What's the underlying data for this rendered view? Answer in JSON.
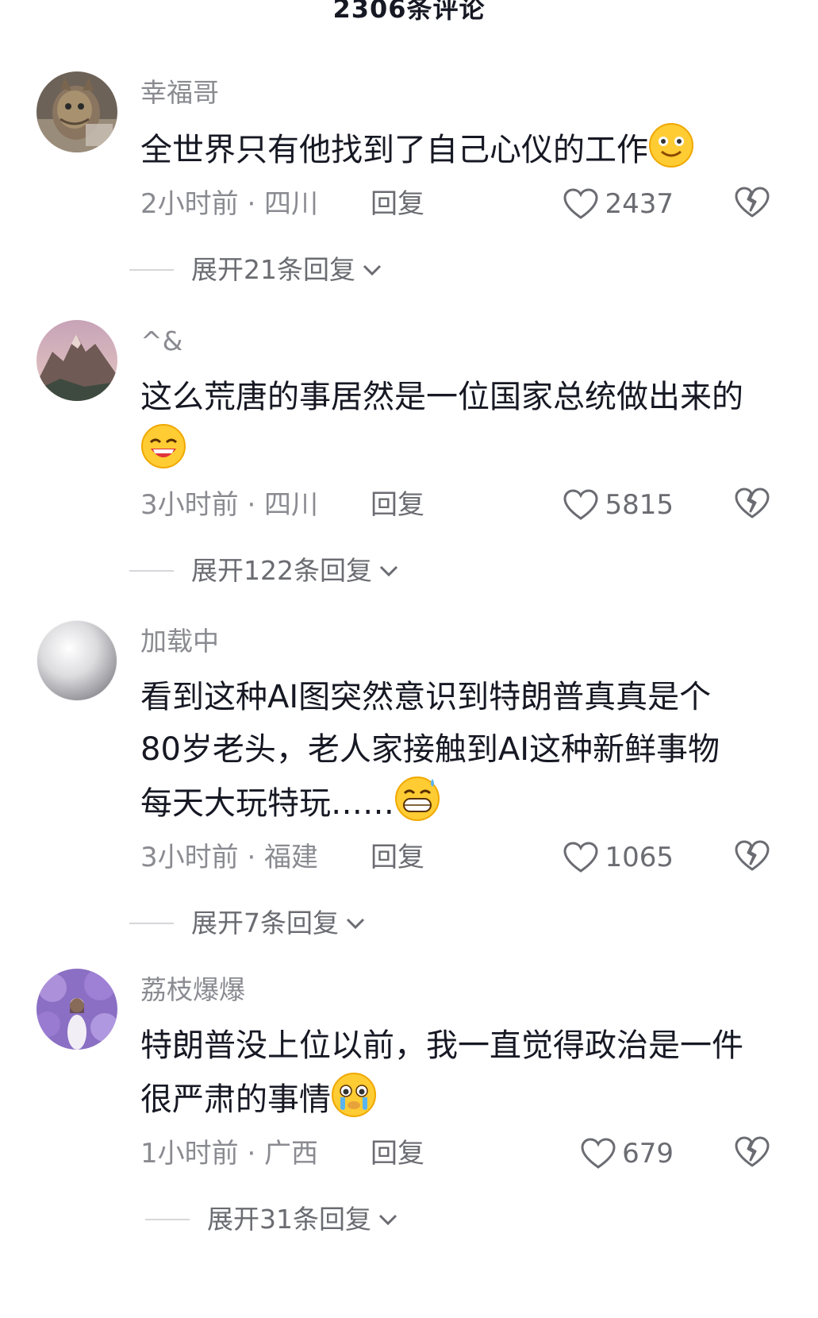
{
  "header": {
    "title": "2306条评论"
  },
  "reply_label": "回复",
  "comments": [
    {
      "username": "幸福哥",
      "text": "全世界只有他找到了自己心仪的工作",
      "emoji": "smile-emoji",
      "time_location": "2小时前 · 四川",
      "likes": "2437",
      "expand": "展开21条回复"
    },
    {
      "username": "^&",
      "text": "这么荒唐的事居然是一位国家总统做出来的",
      "emoji": "grin-emoji",
      "time_location": "3小时前 · 四川",
      "likes": "5815",
      "expand": "展开122条回复"
    },
    {
      "username": "加载中",
      "text": "看到这种AI图突然意识到特朗普真真是个80岁老头，老人家接触到AI这种新鲜事物每天大玩特玩……",
      "emoji": "grimace-sweat-emoji",
      "time_location": "3小时前 · 福建",
      "likes": "1065",
      "expand": "展开7条回复"
    },
    {
      "username": "荔枝爆爆",
      "text": "特朗普没上位以前，我一直觉得政治是一件很严肃的事情",
      "emoji": "teary-emoji",
      "time_location": "1小时前 · 广西",
      "likes": "679",
      "expand": "展开31条回复"
    }
  ],
  "colors": {
    "text_primary": "#161823",
    "text_secondary": "#8a8b91",
    "divider": "#d6d7da"
  }
}
